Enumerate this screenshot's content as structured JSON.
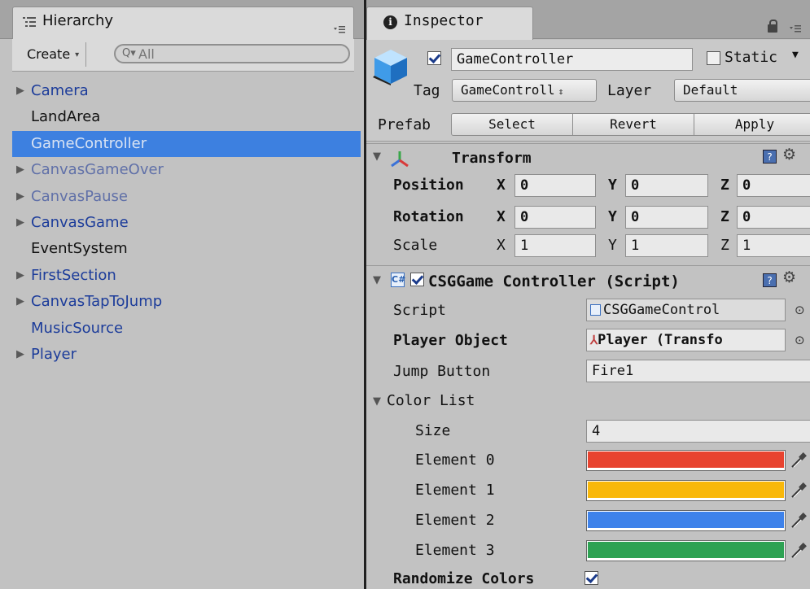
{
  "hierarchy": {
    "tab_title": "Hierarchy",
    "create_label": "Create",
    "search_placeholder": "All",
    "items": [
      {
        "label": "Camera",
        "has_children": true,
        "style": "blue"
      },
      {
        "label": "LandArea",
        "has_children": false,
        "style": "black"
      },
      {
        "label": "GameController",
        "has_children": false,
        "style": "selected"
      },
      {
        "label": "CanvasGameOver",
        "has_children": true,
        "style": "faded"
      },
      {
        "label": "CanvasPause",
        "has_children": true,
        "style": "faded"
      },
      {
        "label": "CanvasGame",
        "has_children": true,
        "style": "blue"
      },
      {
        "label": "EventSystem",
        "has_children": false,
        "style": "black"
      },
      {
        "label": "FirstSection",
        "has_children": true,
        "style": "blue"
      },
      {
        "label": "CanvasTapToJump",
        "has_children": true,
        "style": "blue"
      },
      {
        "label": "MusicSource",
        "has_children": false,
        "style": "blue"
      },
      {
        "label": "Player",
        "has_children": true,
        "style": "blue"
      }
    ]
  },
  "inspector": {
    "tab_title": "Inspector",
    "object_name": "GameController",
    "active": true,
    "static_label": "Static",
    "static_checked": false,
    "tag_label": "Tag",
    "tag_value": "GameControll",
    "layer_label": "Layer",
    "layer_value": "Default",
    "prefab_label": "Prefab",
    "prefab_buttons": {
      "select": "Select",
      "revert": "Revert",
      "apply": "Apply"
    },
    "transform": {
      "title": "Transform",
      "position_label": "Position",
      "rotation_label": "Rotation",
      "scale_label": "Scale",
      "axis_x": "X",
      "axis_y": "Y",
      "axis_z": "Z",
      "position": {
        "x": "0",
        "y": "0",
        "z": "0"
      },
      "rotation": {
        "x": "0",
        "y": "0",
        "z": "0"
      },
      "scale": {
        "x": "1",
        "y": "1",
        "z": "1"
      }
    },
    "script_component": {
      "title": "CSGGame Controller (Script)",
      "enabled": true,
      "script_label": "Script",
      "script_value": "CSGGameControl",
      "player_object_label": "Player Object",
      "player_object_value": "Player (Transfo",
      "jump_button_label": "Jump Button",
      "jump_button_value": "Fire1",
      "color_list_label": "Color List",
      "size_label": "Size",
      "size_value": "4",
      "elements": [
        {
          "label": "Element 0",
          "color": "#e8432f"
        },
        {
          "label": "Element 1",
          "color": "#f9b80a"
        },
        {
          "label": "Element 2",
          "color": "#3e82ea"
        },
        {
          "label": "Element 3",
          "color": "#2ea253"
        }
      ],
      "randomize_label": "Randomize Colors",
      "randomize_checked": true
    }
  }
}
